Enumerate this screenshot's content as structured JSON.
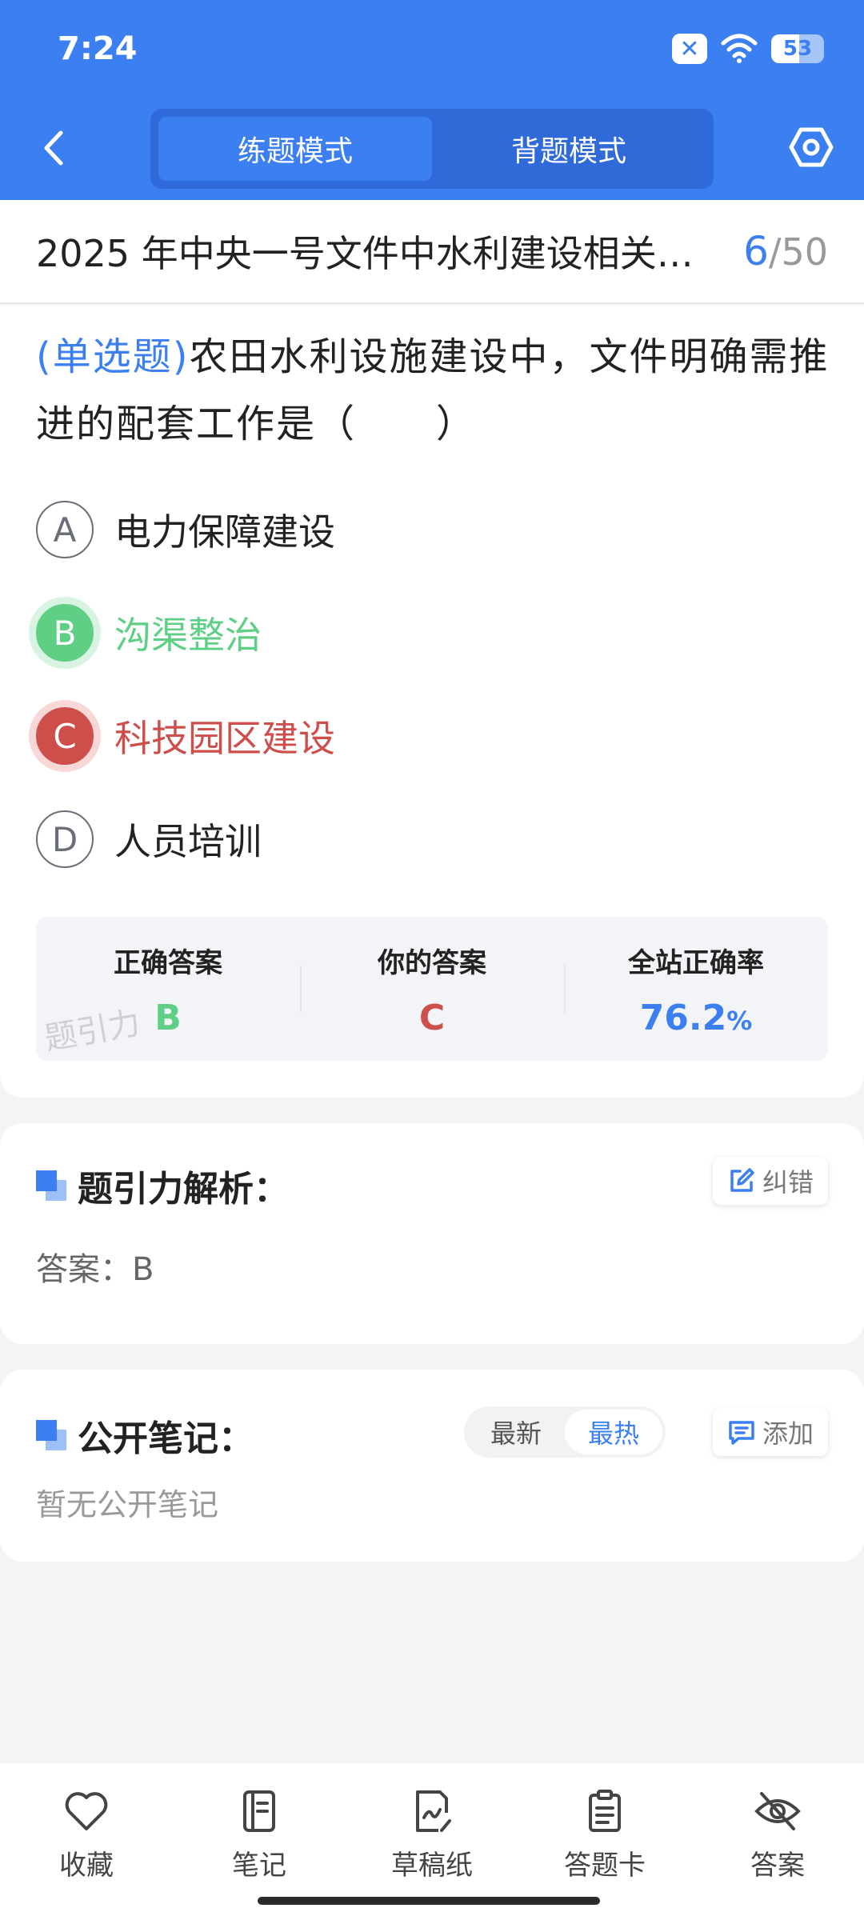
{
  "status_bar": {
    "time": "7:24",
    "battery": "53",
    "battery_level": 0.53,
    "notification_icon": "close-box-icon",
    "wifi_icon": "wifi-icon"
  },
  "header": {
    "tabs": [
      {
        "label": "练题模式",
        "active": true
      },
      {
        "label": "背题模式",
        "active": false
      }
    ],
    "back_icon": "chevron-left-icon",
    "settings_icon": "hexagon-settings-icon"
  },
  "title_bar": {
    "title": "2025 年中央一号文件中水利建设相关…",
    "current": "6",
    "separator": "/",
    "total": "50"
  },
  "question": {
    "type_label": "(单选题)",
    "text": "农田水利设施建设中，文件明确需推进的配套工作是（　　）",
    "options": [
      {
        "letter": "A",
        "text": "电力保障建设",
        "state": "normal"
      },
      {
        "letter": "B",
        "text": "沟渠整治",
        "state": "correct"
      },
      {
        "letter": "C",
        "text": "科技园区建设",
        "state": "wrong"
      },
      {
        "letter": "D",
        "text": "人员培训",
        "state": "normal"
      }
    ]
  },
  "answer_panel": {
    "correct_label": "正确答案",
    "correct_value": "B",
    "your_label": "你的答案",
    "your_value": "C",
    "rate_label": "全站正确率",
    "rate_value": "76.2",
    "rate_unit": "%",
    "watermark": "题引力"
  },
  "analysis": {
    "title": "题引力解析：",
    "correct_button": "纠错",
    "body": "答案：B"
  },
  "notes": {
    "title": "公开笔记：",
    "sort_options": [
      "最新",
      "最热"
    ],
    "active_sort": "最热",
    "add_button": "添加",
    "empty_text": "暂无公开笔记"
  },
  "bottom_nav": [
    {
      "label": "收藏",
      "icon": "heart-icon"
    },
    {
      "label": "笔记",
      "icon": "notebook-icon"
    },
    {
      "label": "草稿纸",
      "icon": "draft-paper-icon"
    },
    {
      "label": "答题卡",
      "icon": "answer-sheet-icon"
    },
    {
      "label": "答案",
      "icon": "eye-off-icon"
    }
  ],
  "colors": {
    "primary": "#3b7ff0",
    "correct": "#5ecf84",
    "wrong": "#cd4e4a"
  }
}
